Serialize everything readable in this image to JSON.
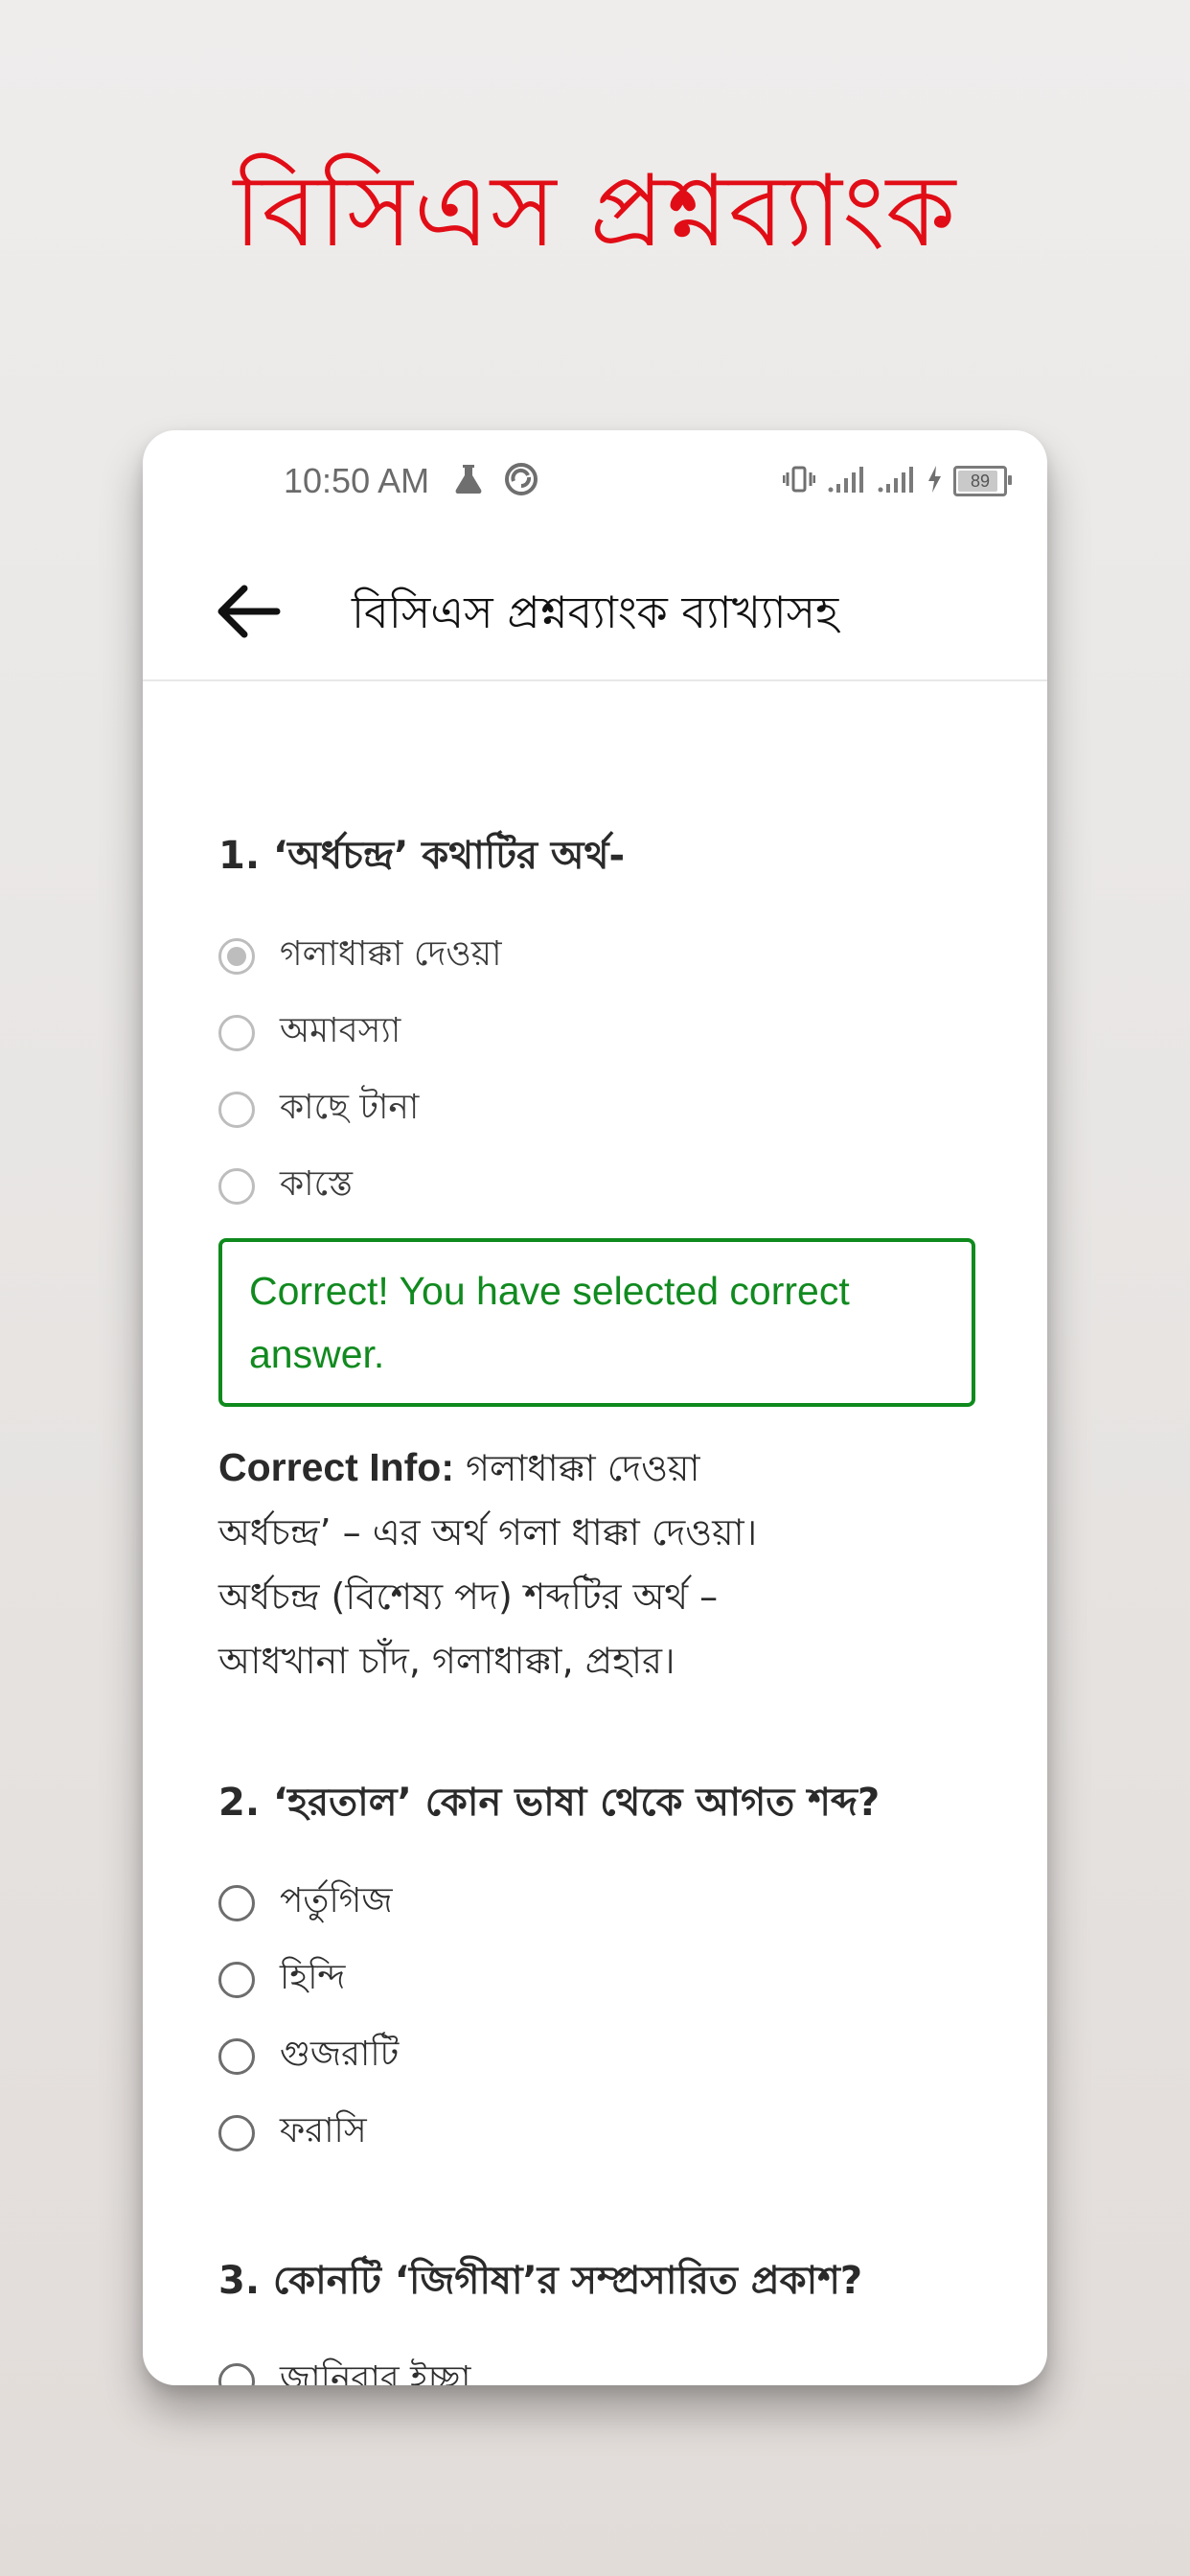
{
  "promo": {
    "title": "বিসিএস প্রশ্নব্যাংক"
  },
  "status_bar": {
    "time": "10:50 AM",
    "battery": "89",
    "battery_level": 0.89
  },
  "app_bar": {
    "title": "বিসিএস প্রশ্নব্যাংক ব্যাখ্যাসহ"
  },
  "colors": {
    "accent_red": "#e10d16",
    "correct_green": "#0f8a1d"
  },
  "questions": [
    {
      "title": "1.  ‘অর্ধচন্দ্র’ কথাটির অর্থ-",
      "options": [
        "গলাধাক্কা দেওয়া",
        "অমাবস্যা",
        "কাছে টানা",
        "কাস্তে"
      ],
      "selected_index": 0,
      "feedback": "Correct! You have selected correct answer.",
      "info_label": "Correct Info:",
      "info_answer": " গলাধাক্কা দেওয়া",
      "info_lines": [
        "অর্ধচন্দ্র’ – এর অর্থ গলা ধাক্কা দেওয়া।",
        "অর্ধচন্দ্র (বিশেষ্য পদ) শব্দটির অর্থ –",
        "আধখানা চাঁদ, গলাধাক্কা, প্রহার।"
      ]
    },
    {
      "title": "2.  ‘হরতাল’ কোন ভাষা থেকে আগত শব্দ?",
      "options": [
        "পর্তুগিজ",
        "হিন্দি",
        "গুজরাটি",
        "ফরাসি"
      ]
    },
    {
      "title": "3.  কোনটি ‘জিগীষা’র সম্প্রসারিত প্রকাশ?",
      "options": [
        "জানিবার ইচ্ছা"
      ]
    }
  ]
}
